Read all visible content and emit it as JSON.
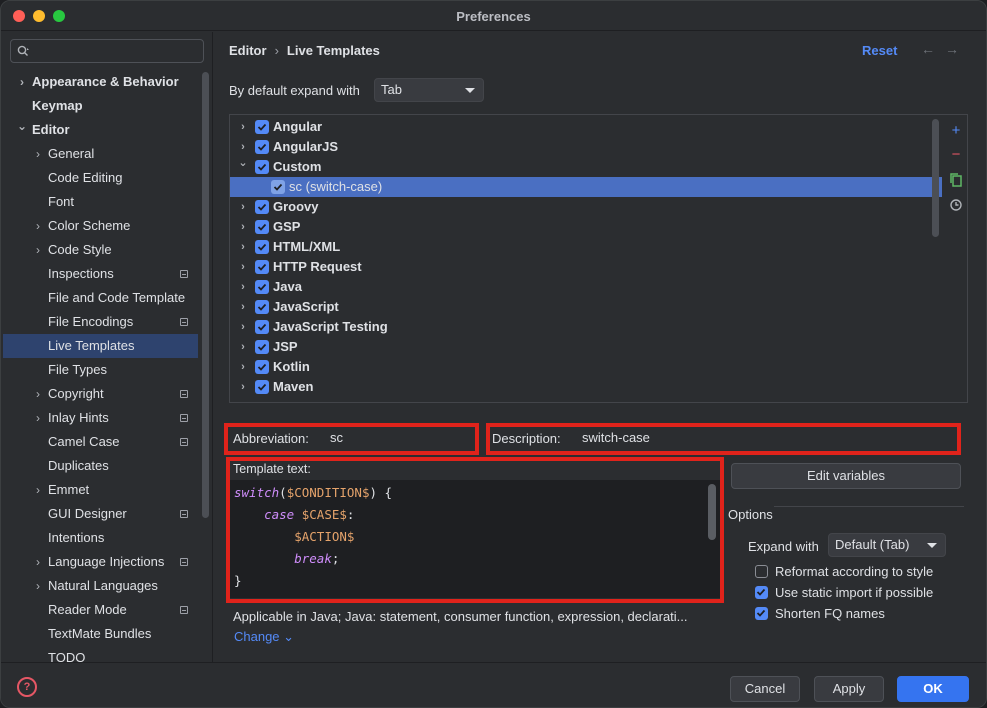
{
  "window": {
    "title": "Preferences"
  },
  "colors": {
    "accent": "#548af7",
    "highlight_box": "#e0231b",
    "selection": "#2e436e"
  },
  "sidebar": {
    "search_placeholder": "",
    "items": [
      {
        "label": "Appearance & Behavior",
        "chevron": ">"
      },
      {
        "label": "Keymap"
      },
      {
        "label": "Editor",
        "chevron": "v"
      },
      {
        "label": "General",
        "chevron": ">"
      },
      {
        "label": "Code Editing"
      },
      {
        "label": "Font"
      },
      {
        "label": "Color Scheme",
        "chevron": ">"
      },
      {
        "label": "Code Style",
        "chevron": ">"
      },
      {
        "label": "Inspections",
        "badge": "settings-scope-icon"
      },
      {
        "label": "File and Code Template"
      },
      {
        "label": "File Encodings",
        "badge": "settings-scope-icon"
      },
      {
        "label": "Live Templates",
        "selected": true
      },
      {
        "label": "File Types"
      },
      {
        "label": "Copyright",
        "chevron": ">",
        "badge": "settings-scope-icon"
      },
      {
        "label": "Inlay Hints",
        "chevron": ">",
        "badge": "settings-scope-icon"
      },
      {
        "label": "Camel Case",
        "badge": "settings-scope-icon"
      },
      {
        "label": "Duplicates"
      },
      {
        "label": "Emmet",
        "chevron": ">"
      },
      {
        "label": "GUI Designer",
        "badge": "settings-scope-icon"
      },
      {
        "label": "Intentions"
      },
      {
        "label": "Language Injections",
        "chevron": ">",
        "badge": "settings-scope-icon"
      },
      {
        "label": "Natural Languages",
        "chevron": ">"
      },
      {
        "label": "Reader Mode",
        "badge": "settings-scope-icon"
      },
      {
        "label": "TextMate Bundles"
      },
      {
        "label": "TODO"
      }
    ]
  },
  "header": {
    "breadcrumb": [
      "Editor",
      "Live Templates"
    ],
    "reset_label": "Reset",
    "back_arrow": "←",
    "forward_arrow": "→"
  },
  "expand": {
    "label": "By default expand with",
    "value": "Tab"
  },
  "templates": {
    "groups": [
      {
        "label": "Angular",
        "chevron": ">",
        "checked": true
      },
      {
        "label": "AngularJS",
        "chevron": ">",
        "checked": true
      },
      {
        "label": "Custom",
        "chevron": "v",
        "checked": true
      },
      {
        "label": "sc (switch-case)",
        "child": true,
        "checked": true,
        "selected": true
      },
      {
        "label": "Groovy",
        "chevron": ">",
        "checked": true
      },
      {
        "label": "GSP",
        "chevron": ">",
        "checked": true
      },
      {
        "label": "HTML/XML",
        "chevron": ">",
        "checked": true
      },
      {
        "label": "HTTP Request",
        "chevron": ">",
        "checked": true
      },
      {
        "label": "Java",
        "chevron": ">",
        "checked": true
      },
      {
        "label": "JavaScript",
        "chevron": ">",
        "checked": true
      },
      {
        "label": "JavaScript Testing",
        "chevron": ">",
        "checked": true
      },
      {
        "label": "JSP",
        "chevron": ">",
        "checked": true
      },
      {
        "label": "Kotlin",
        "chevron": ">",
        "checked": true
      },
      {
        "label": "Maven",
        "chevron": ">",
        "checked": true
      }
    ],
    "tools": [
      "add-icon",
      "remove-icon",
      "copy-icon",
      "restore-icon"
    ]
  },
  "abbreviation": {
    "label": "Abbreviation:",
    "value": "sc"
  },
  "description": {
    "label": "Description:",
    "value": "switch-case"
  },
  "template_text": {
    "label": "Template text:",
    "lines": [
      [
        {
          "t": "switch",
          "c": "kw"
        },
        {
          "t": "(",
          "c": "plain"
        },
        {
          "t": "$CONDITION$",
          "c": "var"
        },
        {
          "t": ") {",
          "c": "plain"
        }
      ],
      [
        {
          "t": "    ",
          "c": "plain"
        },
        {
          "t": "case",
          "c": "kw"
        },
        {
          "t": " ",
          "c": "plain"
        },
        {
          "t": "$CASE$",
          "c": "var"
        },
        {
          "t": ":",
          "c": "plain"
        }
      ],
      [
        {
          "t": "        ",
          "c": "plain"
        },
        {
          "t": "$ACTION$",
          "c": "var"
        }
      ],
      [
        {
          "t": "        ",
          "c": "plain"
        },
        {
          "t": "break",
          "c": "kw"
        },
        {
          "t": ";",
          "c": "plain"
        }
      ],
      [
        {
          "t": "}",
          "c": "plain"
        }
      ]
    ]
  },
  "applicable": {
    "text": "Applicable in Java; Java: statement, consumer function, expression, declarati...",
    "change_label": "Change ⌄"
  },
  "edit_variables_label": "Edit variables",
  "options": {
    "title": "Options",
    "expand_with_label": "Expand with",
    "expand_with_value": "Default (Tab)",
    "checkboxes": [
      {
        "label": "Reformat according to style",
        "checked": false
      },
      {
        "label": "Use static import if possible",
        "checked": true
      },
      {
        "label": "Shorten FQ names",
        "checked": true
      }
    ]
  },
  "footer": {
    "help": "?",
    "cancel": "Cancel",
    "apply": "Apply",
    "ok": "OK"
  }
}
